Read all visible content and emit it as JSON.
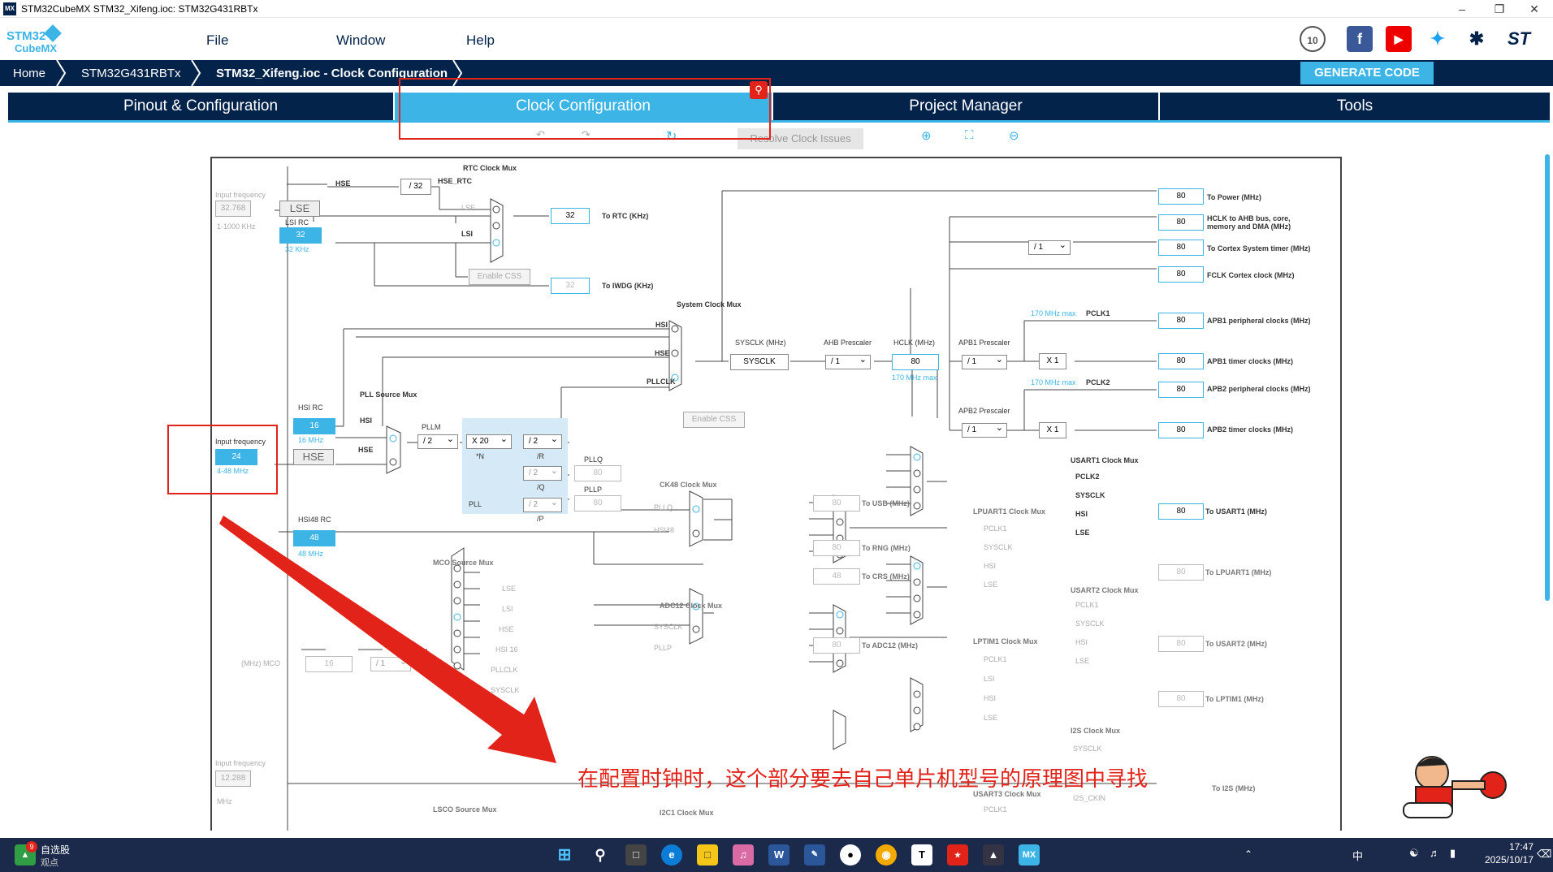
{
  "window": {
    "title": "STM32CubeMX STM32_Xifeng.ioc: STM32G431RBTx",
    "app_icon": "MX"
  },
  "menu": {
    "file": "File",
    "window": "Window",
    "help": "Help"
  },
  "logo": {
    "line1": "STM32",
    "line2": "CubeMX"
  },
  "breadcrumb": {
    "home": "Home",
    "device": "STM32G431RBTx",
    "project": "STM32_Xifeng.ioc - Clock Configuration"
  },
  "generate_label": "GENERATE CODE",
  "tabs": [
    "Pinout & Configuration",
    "Clock Configuration",
    "Project Manager",
    "Tools"
  ],
  "toolbar": {
    "resolve": "Resolve Clock Issues"
  },
  "clock": {
    "rtc_mux_title": "RTC Clock Mux",
    "hse": "HSE",
    "div32": "/ 32",
    "hse_rtc": "HSE_RTC",
    "lse": "LSE",
    "lsi": "LSI",
    "input_freq": "Input frequency",
    "lse_freq": "32.768",
    "lse_range": "1-1000 KHz",
    "lsi_rc": "LSI RC",
    "lsi_val": "32",
    "lsi_unit": "32 KHz",
    "rtc_val": "32",
    "to_rtc": "To RTC (KHz)",
    "enable_css": "Enable CSS",
    "iwdg_val": "32",
    "to_iwdg": "To IWDG (KHz)",
    "sys_mux_title": "System Clock Mux",
    "hsi": "HSI",
    "pllclk": "PLLCLK",
    "sysclk_label": "SYSCLK (MHz)",
    "sysclk": "SYSCLK",
    "ahb_label": "AHB Prescaler",
    "ahb": "/ 1",
    "hclk_label": "HCLK (MHz)",
    "hclk": "80",
    "hclk_max": "170 MHz max",
    "apb1_label": "APB1 Prescaler",
    "apb1": "/ 1",
    "apb2_label": "APB2 Prescaler",
    "apb2": "/ 1",
    "x1": "X 1",
    "pclk1": "PCLK1",
    "pclk2": "PCLK2",
    "max170": "170 MHz max",
    "hsi_rc": "HSI RC",
    "hsi_val": "16",
    "hsi_unit": "16 MHz",
    "pll_src_title": "PLL Source Mux",
    "pllm": "PLLM",
    "pllm_val": "/ 2",
    "plln_val": "X 20",
    "n_label": "*N",
    "pllr_val": "/ 2",
    "r_label": "/R",
    "pllq_val": "/ 2",
    "q_label": "/Q",
    "pllp_val": "/ 2",
    "p_label": "/P",
    "pll_label": "PLL",
    "pllq_label": "PLLQ",
    "pllp_label": "PLLP",
    "pllq_out": "80",
    "pllp_out": "80",
    "hse_input_freq": "24",
    "hse_range": "4-48 MHz",
    "ck48_title": "CK48 Clock Mux",
    "pllq": "PLLQ",
    "hsi48": "HSI48",
    "hsi48_rc": "HSI48 RC",
    "hsi48_val": "48",
    "hsi48_unit": "48 MHz",
    "usb_val": "80",
    "to_usb": "To USB (MHz)",
    "rng_val": "80",
    "to_rng": "To RNG (MHz)",
    "crs_val": "48",
    "to_crs": "To CRS (MHz)",
    "mco_title": "MCO Source Mux",
    "mco_label": "(MHz) MCO",
    "mco_val": "16",
    "mco_div": "/ 1",
    "mco_inputs": [
      "LSE",
      "LSI",
      "HSE",
      "HSI 16",
      "PLLCLK",
      "SYSCLK"
    ],
    "adc_title": "ADC12 Clock Mux",
    "pllp": "PLLP",
    "adc_val": "80",
    "to_adc": "To ADC12 (MHz)",
    "i2s_freq": "12.288",
    "mhz": "MHz",
    "lsco_title": "LSCO Source Mux",
    "i2c1_title": "I2C1 Clock Mux",
    "outputs": [
      {
        "val": "80",
        "label": "To Power (MHz)"
      },
      {
        "val": "80",
        "label": "HCLK to AHB bus, core, memory and DMA (MHz)"
      },
      {
        "val": "80",
        "label": "To Cortex System timer (MHz)"
      },
      {
        "val": "80",
        "label": "FCLK Cortex clock (MHz)"
      },
      {
        "val": "80",
        "label": "APB1 peripheral clocks (MHz)"
      },
      {
        "val": "80",
        "label": "APB1 timer clocks (MHz)"
      },
      {
        "val": "80",
        "label": "APB2 peripheral clocks (MHz)"
      },
      {
        "val": "80",
        "label": "APB2 timer clocks (MHz)"
      }
    ],
    "cortex_div": "/ 1",
    "usart1_title": "USART1 Clock Mux",
    "usart1_val": "80",
    "to_usart1": "To USART1 (MHz)",
    "lpuart1_title": "LPUART1 Clock Mux",
    "lpuart1_val": "80",
    "to_lpuart1": "To LPUART1 (MHz)",
    "usart2_title": "USART2 Clock Mux",
    "usart2_val": "80",
    "to_usart2": "To USART2 (MHz)",
    "lptim1_title": "LPTIM1 Clock Mux",
    "lptim1_val": "80",
    "to_lptim1": "To LPTIM1 (MHz)",
    "i2s_title": "I2S Clock Mux",
    "i2s_ckin": "I2S_CKIN",
    "to_i2s": "To I2S (MHz)",
    "usart3_title": "USART3 Clock Mux"
  },
  "annotation": "在配置时钟时，这个部分要去自己单片机型号的原理图中寻找",
  "taskbar": {
    "stock_label": "自选股",
    "stock_sub": "观点",
    "time": "17:47",
    "date": "2025/10/17",
    "badge": "9",
    "tray_lang": "中"
  },
  "colors": {
    "accent": "#3cb4e6",
    "navy": "#03234b",
    "annotation": "#e2231a"
  }
}
